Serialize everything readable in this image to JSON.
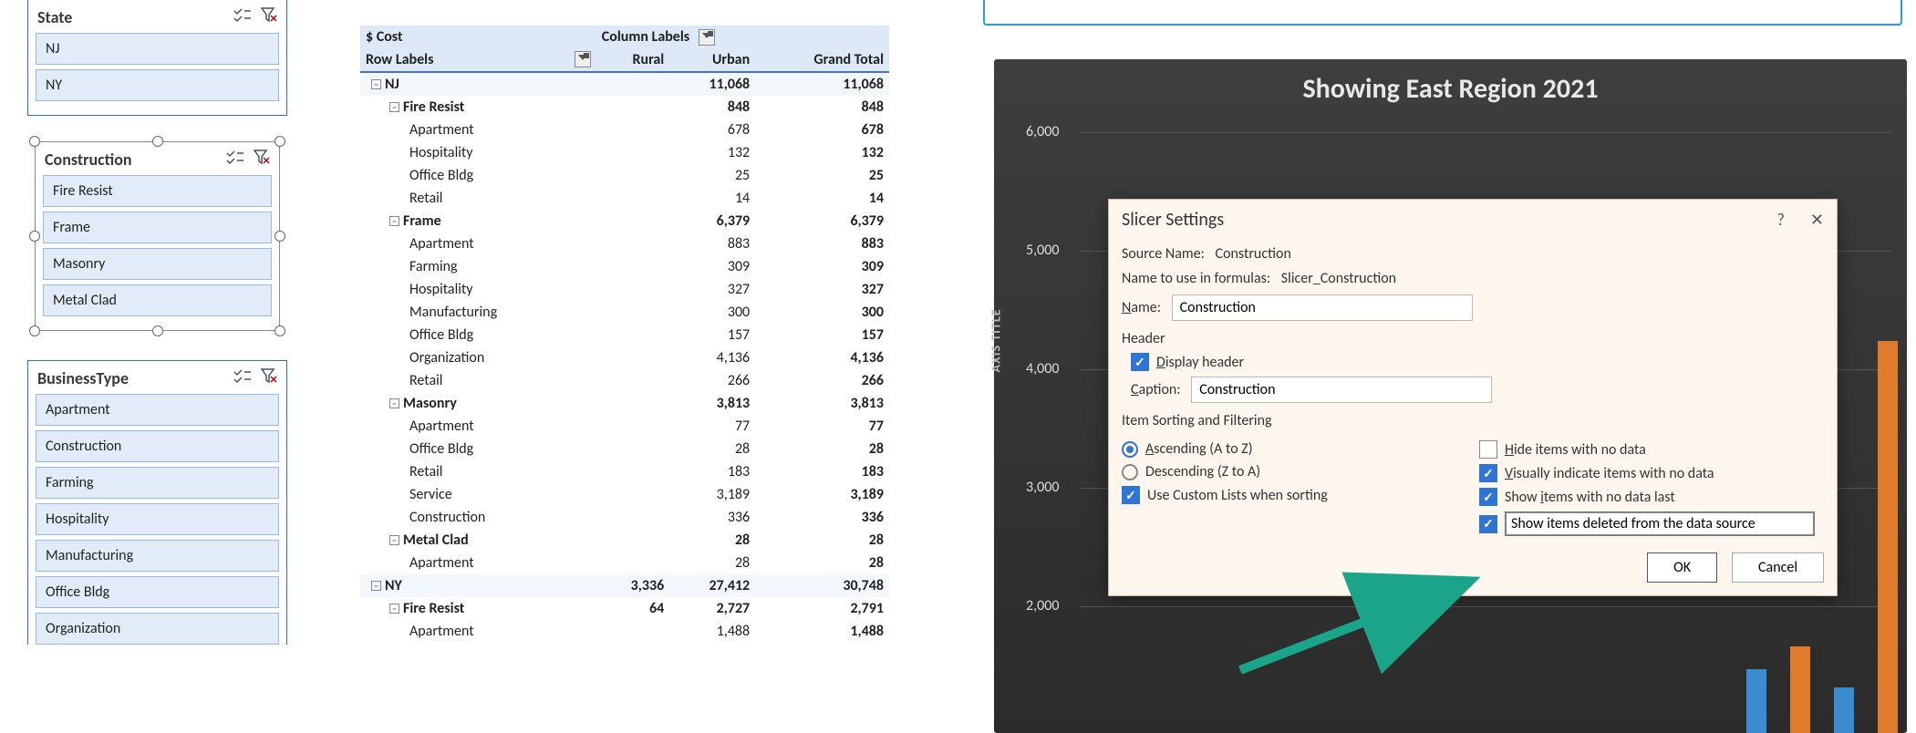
{
  "slicers": {
    "state": {
      "title": "State",
      "items": [
        "NJ",
        "NY"
      ]
    },
    "construction": {
      "title": "Construction",
      "items": [
        "Fire Resist",
        "Frame",
        "Masonry",
        "Metal Clad"
      ]
    },
    "businessType": {
      "title": "BusinessType",
      "items": [
        "Apartment",
        "Construction",
        "Farming",
        "Hospitality",
        "Manufacturing",
        "Office Bldg",
        "Organization"
      ]
    }
  },
  "pivot": {
    "measure": "$ Cost",
    "colHeader": "Column Labels",
    "rowHeader": "Row Labels",
    "cols": [
      "Rural",
      "Urban",
      "Grand Total"
    ],
    "rows": [
      {
        "t": "state",
        "label": "NJ",
        "vals": [
          "",
          "11,068",
          "11,068"
        ]
      },
      {
        "t": "group",
        "label": "Fire Resist",
        "vals": [
          "",
          "848",
          "848"
        ]
      },
      {
        "t": "leaf",
        "label": "Apartment",
        "vals": [
          "",
          "678",
          "678"
        ]
      },
      {
        "t": "leaf",
        "label": "Hospitality",
        "vals": [
          "",
          "132",
          "132"
        ]
      },
      {
        "t": "leaf",
        "label": "Office Bldg",
        "vals": [
          "",
          "25",
          "25"
        ]
      },
      {
        "t": "leaf",
        "label": "Retail",
        "vals": [
          "",
          "14",
          "14"
        ]
      },
      {
        "t": "group",
        "label": "Frame",
        "vals": [
          "",
          "6,379",
          "6,379"
        ]
      },
      {
        "t": "leaf",
        "label": "Apartment",
        "vals": [
          "",
          "883",
          "883"
        ]
      },
      {
        "t": "leaf",
        "label": "Farming",
        "vals": [
          "",
          "309",
          "309"
        ]
      },
      {
        "t": "leaf",
        "label": "Hospitality",
        "vals": [
          "",
          "327",
          "327"
        ]
      },
      {
        "t": "leaf",
        "label": "Manufacturing",
        "vals": [
          "",
          "300",
          "300"
        ]
      },
      {
        "t": "leaf",
        "label": "Office Bldg",
        "vals": [
          "",
          "157",
          "157"
        ]
      },
      {
        "t": "leaf",
        "label": "Organization",
        "vals": [
          "",
          "4,136",
          "4,136"
        ]
      },
      {
        "t": "leaf",
        "label": "Retail",
        "vals": [
          "",
          "266",
          "266"
        ]
      },
      {
        "t": "group",
        "label": "Masonry",
        "vals": [
          "",
          "3,813",
          "3,813"
        ]
      },
      {
        "t": "leaf",
        "label": "Apartment",
        "vals": [
          "",
          "77",
          "77"
        ]
      },
      {
        "t": "leaf",
        "label": "Office Bldg",
        "vals": [
          "",
          "28",
          "28"
        ]
      },
      {
        "t": "leaf",
        "label": "Retail",
        "vals": [
          "",
          "183",
          "183"
        ]
      },
      {
        "t": "leaf",
        "label": "Service",
        "vals": [
          "",
          "3,189",
          "3,189"
        ]
      },
      {
        "t": "leaf",
        "label": "Construction",
        "vals": [
          "",
          "336",
          "336"
        ]
      },
      {
        "t": "group",
        "label": "Metal Clad",
        "vals": [
          "",
          "28",
          "28"
        ]
      },
      {
        "t": "leaf",
        "label": "Apartment",
        "vals": [
          "",
          "28",
          "28"
        ]
      },
      {
        "t": "state",
        "label": "NY",
        "vals": [
          "3,336",
          "27,412",
          "30,748"
        ]
      },
      {
        "t": "group",
        "label": "Fire Resist",
        "vals": [
          "64",
          "2,727",
          "2,791"
        ]
      },
      {
        "t": "leaf",
        "label": "Apartment",
        "vals": [
          "",
          "1,488",
          "1,488"
        ]
      }
    ]
  },
  "chart": {
    "title": "Showing East Region 2021",
    "yaxis_title": "AXIS TITLE",
    "yticks": [
      "6,000",
      "5,000",
      "4,000",
      "3,000",
      "2,000"
    ]
  },
  "chart_data": {
    "type": "bar",
    "title": "Showing East Region 2021",
    "ylabel": "AXIS TITLE",
    "ylim": [
      0,
      6000
    ],
    "note": "Chart largely obscured by dialog; only a few bar tops visible at bottom-right edge."
  },
  "dialog": {
    "title": "Slicer Settings",
    "sourceLabel": "Source Name:",
    "sourceValue": "Construction",
    "formulaLabel": "Name to use in formulas:",
    "formulaValue": "Slicer_Construction",
    "nameLabel": "Name:",
    "nameValue": "Construction",
    "headerSection": "Header",
    "displayHeader": "Display header",
    "captionLabel": "Caption:",
    "captionValue": "Construction",
    "sortSection": "Item Sorting and Filtering",
    "ascending": "Ascending (A to Z)",
    "descending": "Descending (Z to A)",
    "useCustom": "Use Custom Lists when sorting",
    "hideNoData": "Hide items with no data",
    "visually": "Visually indicate items with no data",
    "lastNoData": "Show items with no data last",
    "deletedSrc": "Show items deleted from the data source",
    "ok": "OK",
    "cancel": "Cancel",
    "help": "?",
    "close": "✕"
  }
}
